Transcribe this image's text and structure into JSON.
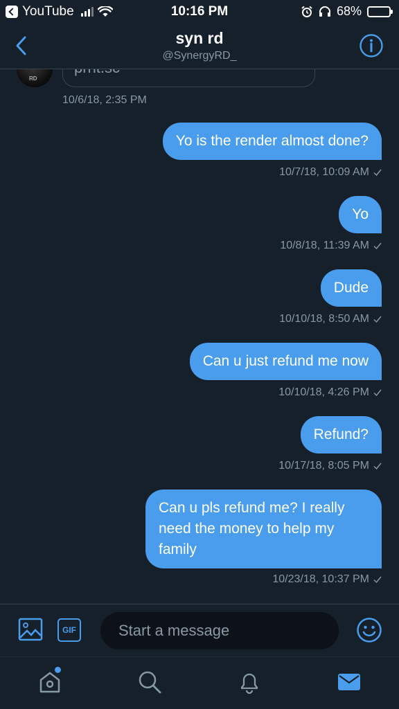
{
  "status_bar": {
    "back_app": "YouTube",
    "time": "10:16 PM",
    "battery": "68%"
  },
  "header": {
    "name": "syn rd",
    "handle": "@SynergyRD_"
  },
  "conversation": {
    "previous_card_text": "prnt.sc",
    "previous_timestamp": "10/6/18, 2:35 PM",
    "messages": [
      {
        "text": "Yo is the render almost done?",
        "timestamp": "10/7/18, 10:09 AM"
      },
      {
        "text": "Yo",
        "timestamp": "10/8/18, 11:39 AM"
      },
      {
        "text": "Dude",
        "timestamp": "10/10/18, 8:50 AM"
      },
      {
        "text": "Can u just refund me now",
        "timestamp": "10/10/18, 4:26 PM"
      },
      {
        "text": "Refund?",
        "timestamp": "10/17/18, 8:05 PM"
      },
      {
        "text": "Can u pls refund me? I really need the money to help my family",
        "timestamp": "10/23/18, 10:37 PM"
      }
    ]
  },
  "composer": {
    "placeholder": "Start a message",
    "gif_label": "GIF"
  },
  "colors": {
    "background": "#15202b",
    "accent": "#4a9ded",
    "muted": "#8899a6",
    "divider": "#38444d"
  },
  "icons": {
    "back": "chevron-left-icon",
    "info": "info-icon",
    "media": "image-icon",
    "emoji": "smiley-icon",
    "tabs": [
      "home-icon",
      "search-icon",
      "bell-icon",
      "envelope-icon"
    ]
  }
}
